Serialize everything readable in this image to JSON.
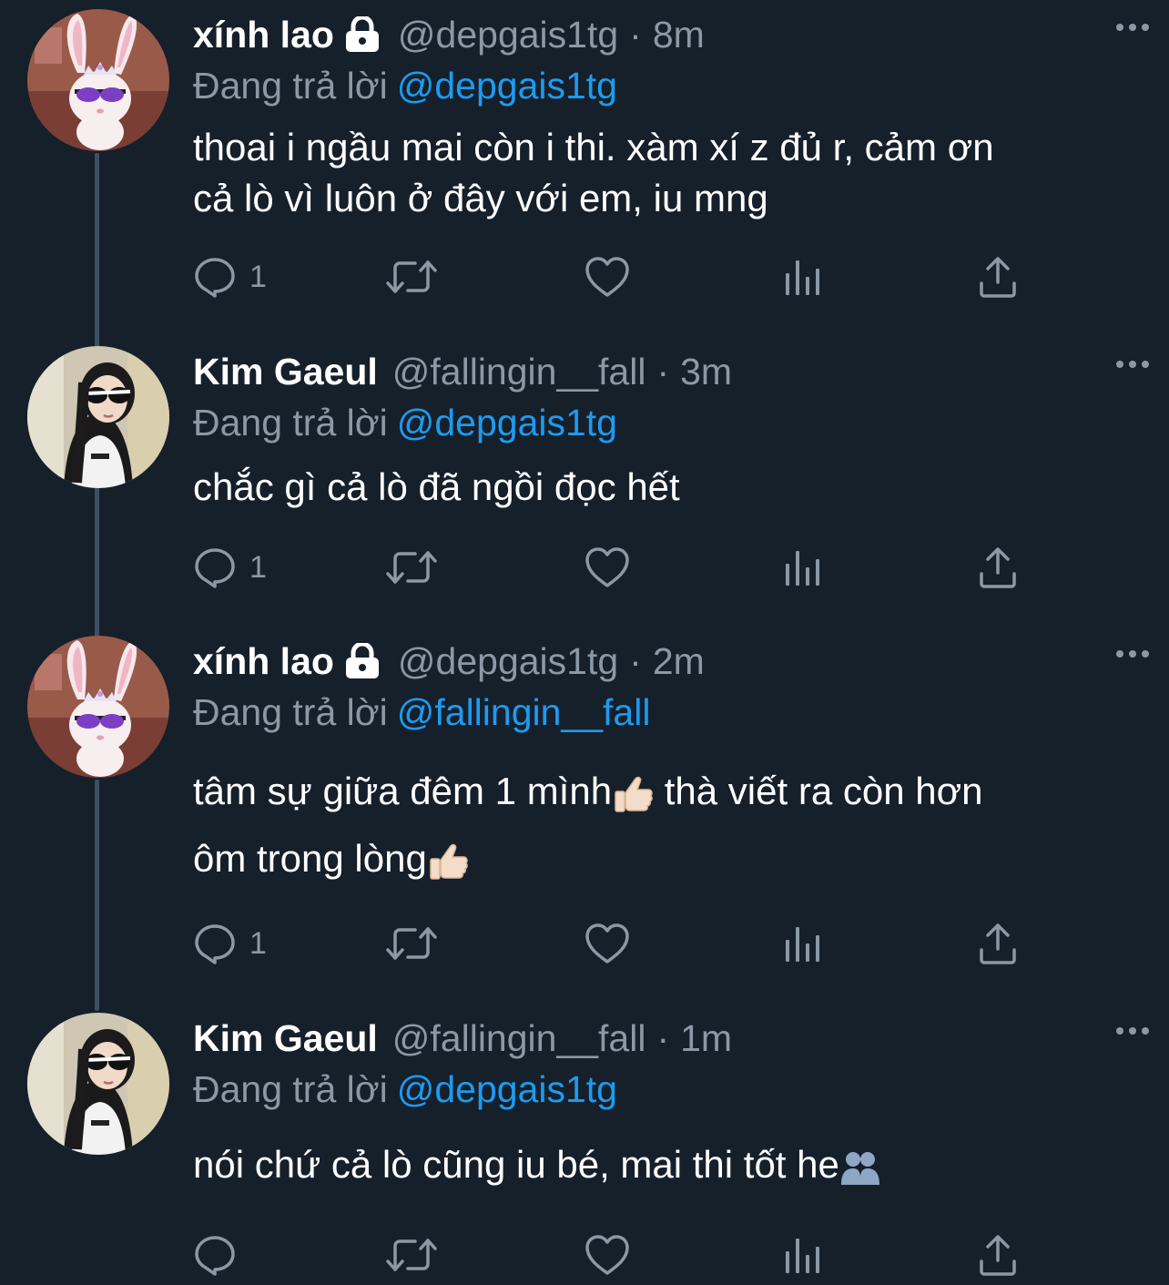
{
  "colors": {
    "background": "#15202b",
    "text_primary": "#ffffff",
    "text_secondary": "#8b98a5",
    "link": "#1d9bf0",
    "thread_line": "#3d4f62"
  },
  "tweets": [
    {
      "display_name": "xính lao",
      "protected": true,
      "handle": "@depgais1tg",
      "dot": "·",
      "time": "8m",
      "reply_prefix": "Đang trả lời",
      "reply_to": "@depgais1tg",
      "text_line_1": "thoai i ngầu mai còn i thi. xàm xí z đủ r, cảm ơn",
      "text_line_2": "cả lò vì luôn ở đây với em, iu mng",
      "reply_count": "1",
      "avatar_icon": "bunny-avatar"
    },
    {
      "display_name": "Kim Gaeul",
      "protected": false,
      "handle": "@fallingin__fall",
      "dot": "·",
      "time": "3m",
      "reply_prefix": "Đang trả lời",
      "reply_to": "@depgais1tg",
      "text_line_1": "chắc gì cả lò đã ngồi đọc hết",
      "reply_count": "1",
      "avatar_icon": "girl-sunglasses-avatar"
    },
    {
      "display_name": "xính lao",
      "protected": true,
      "handle": "@depgais1tg",
      "dot": "·",
      "time": "2m",
      "reply_prefix": "Đang trả lời",
      "reply_to": "@fallingin__fall",
      "text_line_1a": "tâm sự giữa đêm 1 mình",
      "text_line_1b": " thà viết ra còn hơn",
      "text_line_2": "ôm trong lòng",
      "reply_count": "1",
      "avatar_icon": "bunny-avatar",
      "emoji_icon": "thumbs-up-emoji"
    },
    {
      "display_name": "Kim Gaeul",
      "protected": false,
      "handle": "@fallingin__fall",
      "dot": "·",
      "time": "1m",
      "reply_prefix": "Đang trả lời",
      "reply_to": "@depgais1tg",
      "text_line_1": "nói chứ cả lò cũng iu bé, mai thi tốt he",
      "reply_count": "",
      "avatar_icon": "girl-sunglasses-avatar",
      "emoji_icon": "hugging-people-emoji"
    }
  ]
}
